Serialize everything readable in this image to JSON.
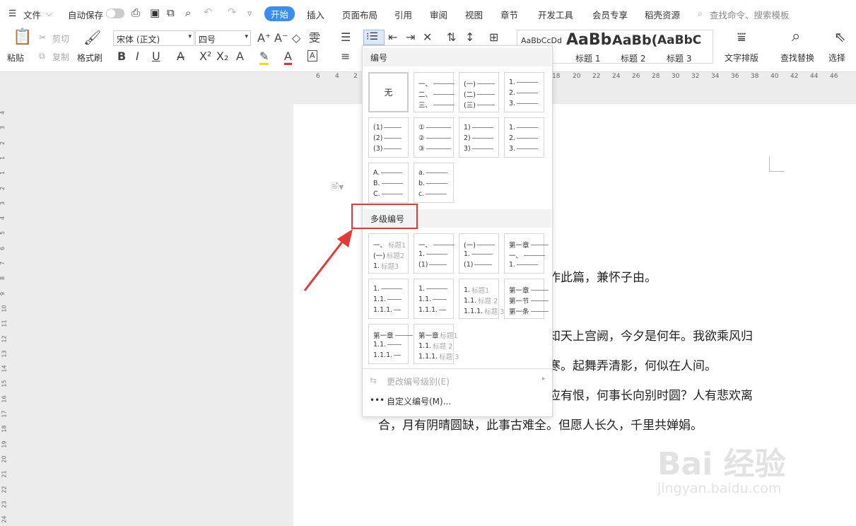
{
  "menubar": {
    "file": "文件",
    "autosave": "自动保存",
    "tabs": [
      "开始",
      "插入",
      "页面布局",
      "引用",
      "审阅",
      "视图",
      "章节",
      "开发工具",
      "会员专享",
      "稻壳资源"
    ],
    "search": "查找命令、搜索模板"
  },
  "ribbon": {
    "paste": "粘贴",
    "cut": "剪切",
    "copy": "复制",
    "format_painter": "格式刷",
    "font": "宋体 (正文)",
    "size": "四号",
    "styles": {
      "normal": "AaBbCcDd",
      "h1_preview": "AaBb",
      "h2_preview": "AaBb(",
      "h3_preview": "AaBbC",
      "h1": "标题 1",
      "h2": "标题 2",
      "h3": "标题 3"
    },
    "text_layout": "文字排版",
    "find_replace": "查找替换",
    "select": "选择"
  },
  "ruler": {
    "h": [
      "6",
      "4",
      "2",
      "18",
      "20",
      "22",
      "24",
      "26",
      "28",
      "30",
      "32",
      "34",
      "36",
      "38",
      "40",
      "42",
      "44",
      "46"
    ],
    "v": [
      "4",
      "3",
      "2",
      "1",
      "1",
      "2",
      "3",
      "4",
      "5",
      "6",
      "7",
      "8",
      "9",
      "10",
      "11",
      "12",
      "13",
      "14",
      "15",
      "16",
      "17",
      "18",
      "19",
      "20",
      "21",
      "22",
      "23",
      "24"
    ]
  },
  "document": {
    "lines": [
      "作此篇，兼怀子由。",
      "知天上宫阙，今夕是何年。我欲乘风归",
      "寒。起舞弄清影，何似在人间。",
      "应有恨，何事长向别时圆？人有悲欢离",
      "合，月有阴晴圆缺，此事古难全。但愿人长久，千里共婵娟。"
    ]
  },
  "menu": {
    "numbering_title": "编号",
    "none": "无",
    "single": [
      [
        "一、",
        "二、",
        "三、"
      ],
      [
        "(一)",
        "(二)",
        "(三)"
      ],
      [
        "1.",
        "2.",
        "3."
      ],
      [
        "(1)",
        "(2)",
        "(3)"
      ],
      [
        "①",
        "②",
        "③"
      ],
      [
        "1)",
        "2)",
        "3)"
      ],
      [
        "1.",
        "2.",
        "3."
      ],
      [
        "A.",
        "B.",
        "C."
      ],
      [
        "a.",
        "b.",
        "c."
      ]
    ],
    "multilevel_title": "多级编号",
    "multi": [
      [
        [
          "一、",
          "标题1"
        ],
        [
          "(一)",
          "标题2"
        ],
        [
          "1.",
          "标题3"
        ]
      ],
      [
        [
          "一、",
          ""
        ],
        [
          "1.",
          ""
        ],
        [
          "(1)",
          ""
        ]
      ],
      [
        [
          "(一)",
          ""
        ],
        [
          "1.",
          ""
        ],
        [
          "(1)",
          ""
        ]
      ],
      [
        [
          "第一章",
          ""
        ],
        [
          "一、",
          ""
        ],
        [
          "1.",
          ""
        ]
      ],
      [
        [
          "1.",
          ""
        ],
        [
          "1.1.",
          ""
        ],
        [
          "1.1.1.",
          ""
        ]
      ],
      [
        [
          "1.",
          ""
        ],
        [
          "1.1.",
          ""
        ],
        [
          "1.1.1.",
          ""
        ]
      ],
      [
        [
          "1.",
          "标题1"
        ],
        [
          "1.1.",
          "标题 2"
        ],
        [
          "1.1.1.",
          "标题 3"
        ]
      ],
      [
        [
          "第一章",
          ""
        ],
        [
          "第一节",
          ""
        ],
        [
          "第一条",
          ""
        ]
      ],
      [
        [
          "第一章",
          ""
        ],
        [
          "1.1.",
          ""
        ],
        [
          "1.1.1.",
          ""
        ]
      ],
      [
        [
          "第一章",
          "标题1"
        ],
        [
          "1.1.",
          "标题 2"
        ],
        [
          "1.1.1.",
          "标题 3"
        ]
      ]
    ],
    "change_level": "更改编号级别(E)",
    "custom": "自定义编号(M)..."
  },
  "watermark": {
    "brand": "Bai  经验",
    "url": "jingyan.baidu.com"
  }
}
